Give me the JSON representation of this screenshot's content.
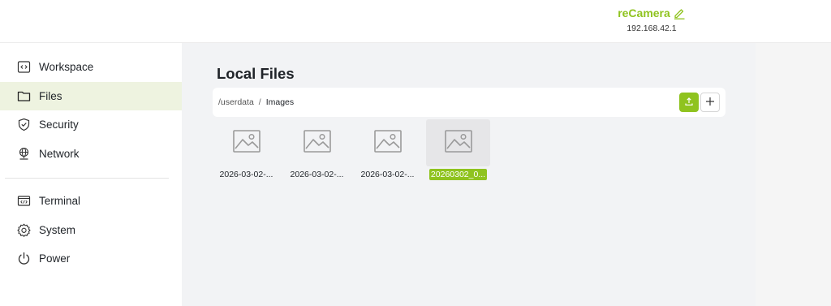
{
  "header": {
    "device_name": "reCamera",
    "device_ip": "192.168.42.1"
  },
  "sidebar": {
    "items": [
      {
        "label": "Workspace",
        "icon": "code-window-icon"
      },
      {
        "label": "Files",
        "icon": "folder-icon",
        "active": true
      },
      {
        "label": "Security",
        "icon": "shield-icon"
      },
      {
        "label": "Network",
        "icon": "globe-icon"
      },
      {
        "label": "Terminal",
        "icon": "terminal-icon"
      },
      {
        "label": "System",
        "icon": "gear-icon"
      },
      {
        "label": "Power",
        "icon": "power-icon"
      }
    ]
  },
  "main": {
    "title": "Local Files",
    "path": {
      "root": "/userdata",
      "separator": "/",
      "current": "Images"
    },
    "files": [
      {
        "name": "2026-03-02-...",
        "selected": false
      },
      {
        "name": "2026-03-02-...",
        "selected": false
      },
      {
        "name": "2026-03-02-...",
        "selected": false
      },
      {
        "name": "20260302_0...",
        "selected": true
      }
    ]
  },
  "colors": {
    "accent": "#8fc31f",
    "active_bg": "#eef3e0",
    "main_bg": "#f2f3f5"
  }
}
